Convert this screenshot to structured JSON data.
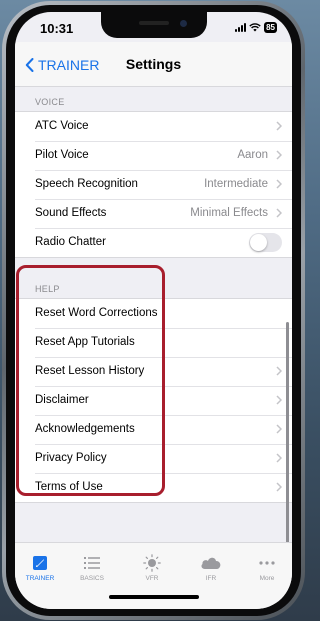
{
  "status_bar": {
    "time": "10:31",
    "battery": "85"
  },
  "nav": {
    "back_label": "TRAINER",
    "title": "Settings"
  },
  "voice_section": {
    "header": "VOICE",
    "rows": [
      {
        "label": "ATC Voice",
        "value": ""
      },
      {
        "label": "Pilot Voice",
        "value": "Aaron"
      },
      {
        "label": "Speech Recognition",
        "value": "Intermediate"
      },
      {
        "label": "Sound Effects",
        "value": "Minimal Effects"
      },
      {
        "label": "Radio Chatter",
        "toggle_on": false
      }
    ]
  },
  "help_section": {
    "header": "HELP",
    "rows": [
      {
        "label": "Reset Word Corrections"
      },
      {
        "label": "Reset App Tutorials"
      },
      {
        "label": "Reset Lesson History"
      },
      {
        "label": "Disclaimer"
      },
      {
        "label": "Acknowledgements"
      },
      {
        "label": "Privacy Policy"
      },
      {
        "label": "Terms of Use"
      }
    ]
  },
  "tab_bar": {
    "tabs": [
      {
        "label": "TRAINER",
        "icon": "trainer-icon",
        "active": true
      },
      {
        "label": "BASICS",
        "icon": "list-icon"
      },
      {
        "label": "VFR",
        "icon": "sun-icon"
      },
      {
        "label": "IFR",
        "icon": "cloud-icon"
      },
      {
        "label": "More",
        "icon": "more-icon"
      }
    ]
  },
  "colors": {
    "accent": "#1a73e8",
    "highlight_border": "#a81e2d",
    "background": "#efeff4"
  }
}
